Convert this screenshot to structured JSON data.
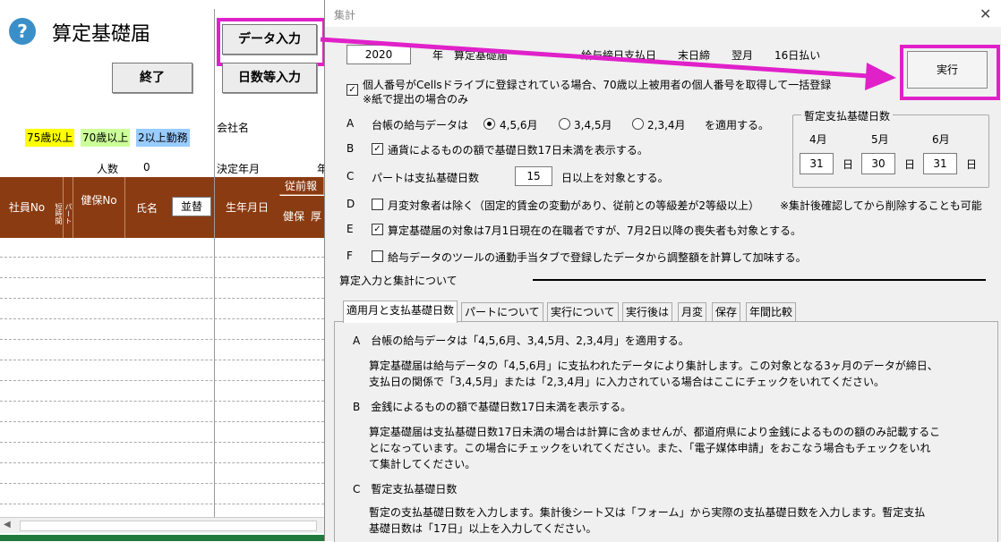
{
  "sheet": {
    "title": "算定基礎届",
    "data_input_button": "データ入力",
    "exit_button": "終了",
    "days_input_button": "日数等入力",
    "company_label": "会社名",
    "legend_75": "75歳以上",
    "legend_70": "70歳以上",
    "legend_2": "2以上勤務",
    "count_label": "人数",
    "count_value": "0",
    "decision_year_label": "決定年月",
    "col_employee_no": "社員No",
    "col_short": "短時間",
    "col_part": "パート",
    "col_health_no": "健保No",
    "col_name": "氏名",
    "sort_button": "並替",
    "col_birth": "生年月日",
    "col_previous": "従前報酬",
    "col_health": "健保",
    "col_pension": "厚",
    "trailing_char": "年",
    "colors": {
      "header": "#8b3b12",
      "legend75": "#ffff00",
      "legend70": "#ccff99",
      "legend2": "#99ccff"
    }
  },
  "dialog": {
    "title": "集計",
    "close_icon": "close-icon",
    "year": "2020",
    "year_suffix": "年",
    "form_name": "算定基礎届",
    "pay_info": "給与締日支払日　　末日締　　翌月　　16日払い",
    "execute_button": "実行",
    "mynumber_check": "個人番号がCellsドライブに登録されている場合、70歳以上被用者の個人番号を取得して一括登録",
    "mynumber_note": "※紙で提出の場合のみ",
    "row_a_letter": "A",
    "row_a_label": "台帳の給与データは",
    "radio_1": "4,5,6月",
    "radio_2": "3,4,5月",
    "radio_3": "2,3,4月",
    "row_a_suffix": "を適用する。",
    "row_b_letter": "B",
    "row_b_label": "通貨によるものの額で基礎日数17日未満を表示する。",
    "row_c_letter": "C",
    "row_c_label": "パートは支払基礎日数",
    "row_c_value": "15",
    "row_c_suffix": "日以上を対象とする。",
    "row_d_letter": "D",
    "row_d_label": "月変対象者は除く（固定的賃金の変動があり、従前との等級差が2等級以上）",
    "row_d_note": "※集計後確認してから削除することも可能",
    "row_e_letter": "E",
    "row_e_label": "算定基礎届の対象は7月1日現在の在職者ですが、7月2日以降の喪失者も対象とする。",
    "row_f_letter": "F",
    "row_f_label": "給与データのツールの通勤手当タブで登録したデータから調整額を計算して加味する。",
    "provisional": {
      "title": "暫定支払基礎日数",
      "months": [
        "4月",
        "5月",
        "6月"
      ],
      "values": [
        "31",
        "30",
        "31"
      ],
      "day_unit": "日"
    },
    "section_title": "算定入力と集計について",
    "tabs": [
      "適用月と支払基礎日数",
      "パートについて",
      "実行について",
      "実行後は",
      "月変",
      "保存",
      "年間比較"
    ],
    "panel": {
      "a_head": "A　台帳の給与データは「4,5,6月、3,4,5月、2,3,4月」を適用する。",
      "a_line1": "算定基礎届は給与データの「4,5,6月」に支払われたデータにより集計します。この対象となる3ヶ月のデータが締日、",
      "a_line2": "支払日の関係で「3,4,5月」または「2,3,4月」に入力されている場合はここにチェックをいれてください。",
      "b_head": "B　金銭によるものの額で基礎日数17日未満を表示する。",
      "b_line1": "算定基礎届は支払基礎日数17日未満の場合は計算に含めませんが、都道府県により金銭によるものの額のみ記載するこ",
      "b_line2": "とになっています。この場合にチェックをいれてください。また、「電子媒体申請」をおこなう場合もチェックをいれ",
      "b_line3": "て集計してください。",
      "c_head": "C　暫定支払基礎日数",
      "c_line1": "暫定の支払基礎日数を入力します。集計後シート又は「フォーム」から実際の支払基礎日数を入力します。暫定支払",
      "c_line2": "基礎日数は「17日」以上を入力してください。"
    },
    "colors": {
      "highlight": "#e021c9"
    }
  }
}
